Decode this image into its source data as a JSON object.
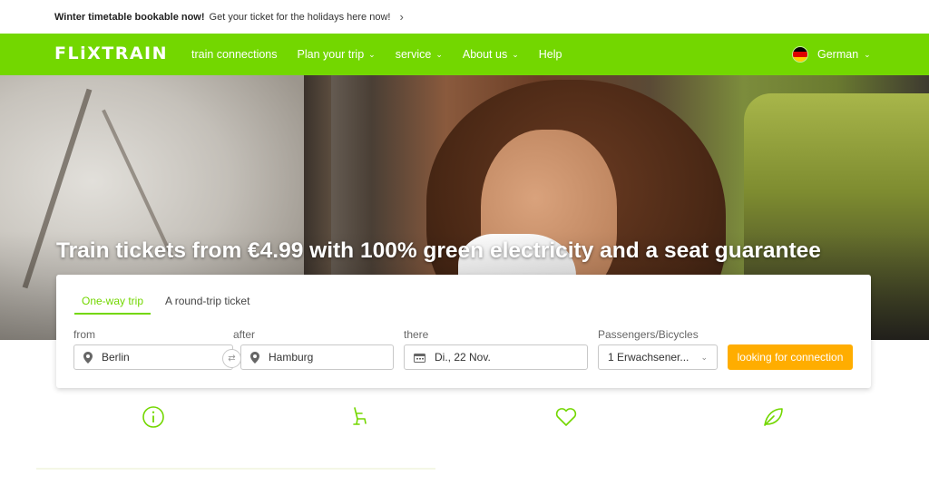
{
  "banner": {
    "bold": "Winter timetable bookable now!",
    "message": "Get your ticket for the holidays here now!",
    "chevron": "›"
  },
  "nav": {
    "logo": "FLiXTRAIN",
    "items": [
      {
        "label": "train connections",
        "has_caret": false
      },
      {
        "label": "Plan your trip",
        "has_caret": true
      },
      {
        "label": "service",
        "has_caret": true
      },
      {
        "label": "About us",
        "has_caret": true
      },
      {
        "label": "Help",
        "has_caret": false
      }
    ],
    "language": "German",
    "flag_colors": [
      "#000000",
      "#dd0000",
      "#ffce00"
    ]
  },
  "hero": {
    "headline": "Train tickets from €4.99 with 100% green electricity and a seat guarantee"
  },
  "search": {
    "tabs": [
      {
        "label": "One-way trip",
        "active": true
      },
      {
        "label": "A round-trip ticket",
        "active": false
      }
    ],
    "from_label": "from",
    "from_value": "Berlin",
    "after_label": "after",
    "after_value": "Hamburg",
    "there_label": "there",
    "date_value": "Di., 22 Nov.",
    "passengers_label": "Passengers/Bicycles",
    "passengers_value": "1 Erwachsener...",
    "button": "looking for connection"
  },
  "features": [
    {
      "icon": "info-icon"
    },
    {
      "icon": "seat-icon"
    },
    {
      "icon": "heart-icon"
    },
    {
      "icon": "leaf-icon"
    }
  ],
  "colors": {
    "brand_green": "#73d700",
    "cta_orange": "#ffad00"
  }
}
